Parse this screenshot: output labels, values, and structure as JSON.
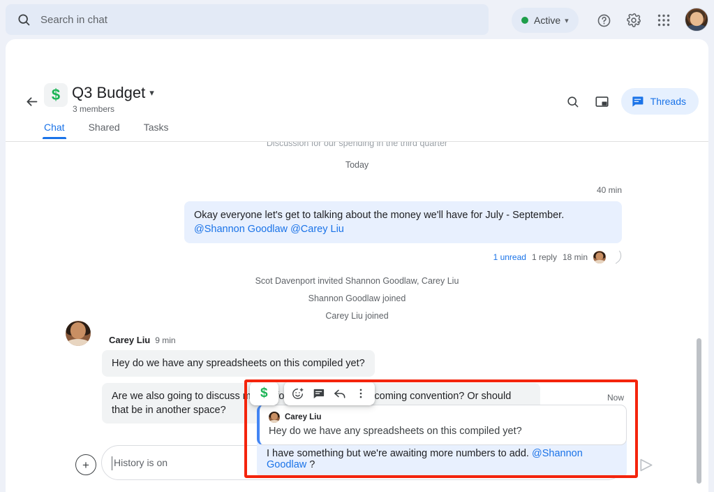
{
  "topbar": {
    "search_placeholder": "Search in chat",
    "search_icon": "search-icon",
    "status_label": "Active",
    "status_color": "#1e9e4a",
    "help_icon": "help-circle-icon",
    "settings_icon": "gear-icon",
    "apps_icon": "apps-grid-icon",
    "avatar": "user-avatar"
  },
  "space": {
    "back_icon": "back-arrow-icon",
    "emoji": "$",
    "title": "Q3 Budget",
    "caret": "˅",
    "members": "3 members",
    "search_icon": "search-icon",
    "pip_icon": "picture-in-picture-icon",
    "threads_label": "Threads",
    "threads_icon": "chat-bubble-icon"
  },
  "tabs": [
    {
      "label": "Chat",
      "active": true
    },
    {
      "label": "Shared",
      "active": false
    },
    {
      "label": "Tasks",
      "active": false
    }
  ],
  "messages": {
    "description": "Discussion for our spending in the third quarter",
    "day_divider": "Today",
    "first": {
      "timestamp": "40 min",
      "text_before": "Okay everyone let's get to talking about the money we'll have  for July - September. ",
      "mention1": "@Shannon Goodlaw",
      "mention_sep": " ",
      "mention2": "@Carey Liu"
    },
    "thread_meta": {
      "unread": "1 unread",
      "replies": "1 reply",
      "timestamp": "18 min"
    },
    "system": [
      "Scot Davenport invited Shannon Goodlaw, Carey Liu",
      "Shannon Goodlaw joined",
      "Carey Liu joined"
    ],
    "carey": {
      "name": "Carey Liu",
      "timestamp": "9 min",
      "msg1": "Hey do we have any spreadsheets on this compiled yet?",
      "msg2": "Are we also going to discuss money for the travel to the upcoming convention? Or should that be in another space?"
    }
  },
  "hover_toolbar": {
    "emoji": "$",
    "add_reaction_icon": "add-reaction-icon",
    "reply_in_thread_icon": "reply-in-thread-icon",
    "reply_icon": "reply-arrow-icon",
    "more_icon": "more-vertical-icon"
  },
  "thread_reply": {
    "timestamp": "Now",
    "quote_author": "Carey Liu",
    "quote_text": "Hey do we have any spreadsheets on this compiled yet?",
    "reply_before": "I have something but we're awaiting more numbers to add. ",
    "reply_mention": "@Shannon Goodlaw",
    "reply_after": " ?"
  },
  "composer": {
    "plus_icon": "add-attachment-icon",
    "plus_glyph": "+",
    "placeholder": "History is on",
    "icons": [
      "format-text-icon",
      "emoji-icon",
      "gif-icon",
      "upload-icon",
      "video-icon"
    ],
    "send_icon": "send-icon"
  },
  "annotation": {
    "highlight_color": "#f4240c"
  }
}
